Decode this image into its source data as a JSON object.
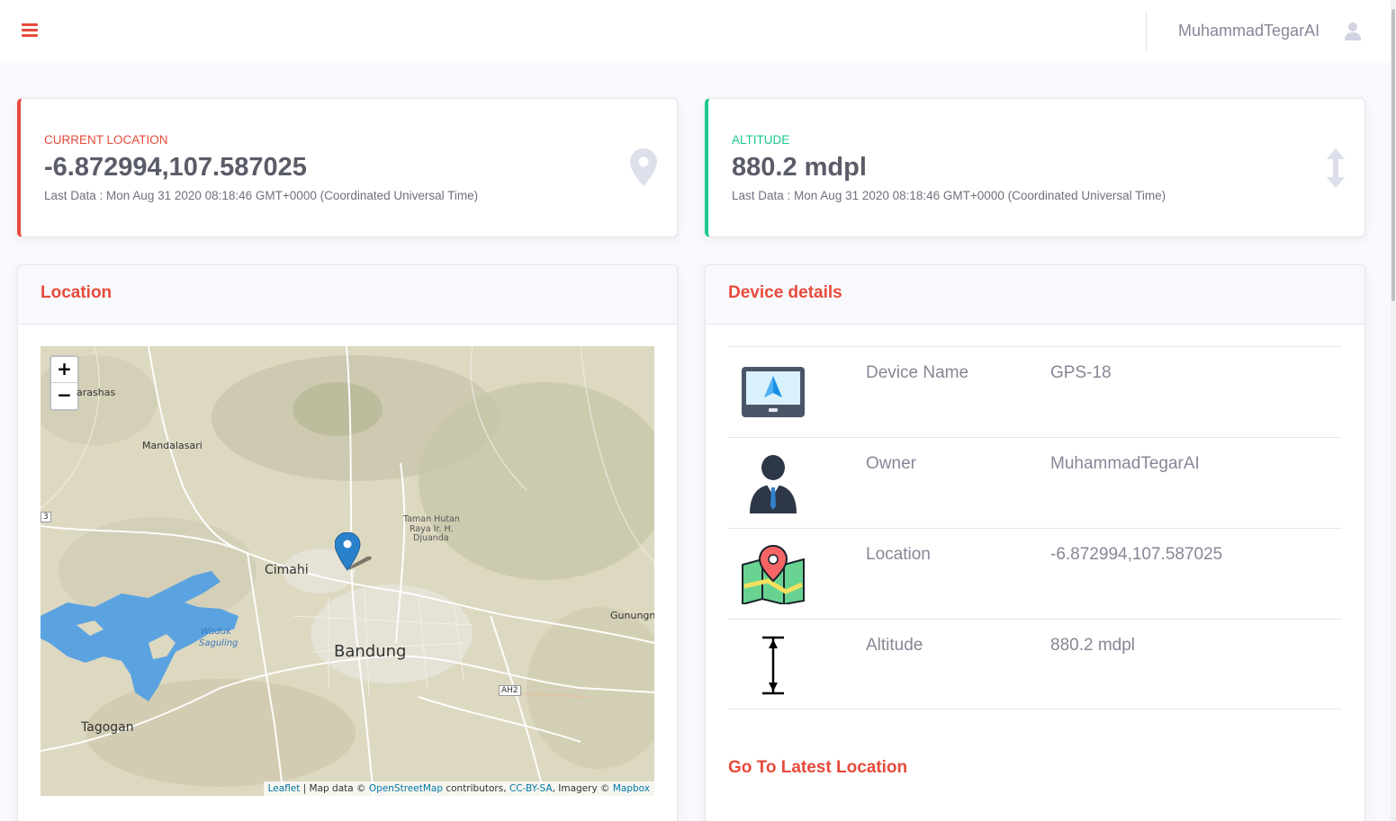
{
  "topbar": {
    "user_name": "MuhammadTegarAI"
  },
  "stats": {
    "location": {
      "label": "CURRENT LOCATION",
      "value": "-6.872994,107.587025",
      "sub": "Last Data : Mon Aug 31 2020 08:18:46 GMT+0000 (Coordinated Universal Time)",
      "icon": "map-marker-icon"
    },
    "altitude": {
      "label": "ALTITUDE",
      "value": "880.2 mdpl",
      "sub": "Last Data : Mon Aug 31 2020 08:18:46 GMT+0000 (Coordinated Universal Time)",
      "icon": "arrows-vertical-icon"
    }
  },
  "location_panel": {
    "title": "Location",
    "map": {
      "zoom_in": "+",
      "zoom_out": "−",
      "labels": {
        "harashas": "arashas",
        "mandalasari": "Mandalasari",
        "cimahi": "Cimahi",
        "bandung": "Bandung",
        "taman": "Taman Hutan",
        "raya": "Raya Ir. H.",
        "djuanda": "Djuanda",
        "gunung": "Gunungn",
        "waduk": "Waduk",
        "saguling": "Saguling",
        "tagogan": "Tagogan",
        "ah2": "AH2",
        "route3": "3"
      },
      "attribution": {
        "leaflet": "Leaflet",
        "sep1": " | Map data © ",
        "osm": "OpenStreetMap",
        "mid": " contributors, ",
        "license": "CC-BY-SA",
        "imagery": ", Imagery © ",
        "mapbox": "Mapbox"
      }
    }
  },
  "device_panel": {
    "title": "Device details",
    "rows": [
      {
        "icon": "gps-device-icon",
        "key": "Device Name",
        "value": "GPS-18"
      },
      {
        "icon": "owner-icon",
        "key": "Owner",
        "value": "MuhammadTegarAI"
      },
      {
        "icon": "map-location-icon",
        "key": "Location",
        "value": "-6.872994,107.587025"
      },
      {
        "icon": "altitude-icon",
        "key": "Altitude",
        "value": "880.2 mdpl"
      }
    ],
    "goto_label": "Go To Latest Location"
  },
  "colors": {
    "primary_red": "#e74a3b",
    "success_green": "#1cc88a",
    "text_gray": "#858796"
  }
}
